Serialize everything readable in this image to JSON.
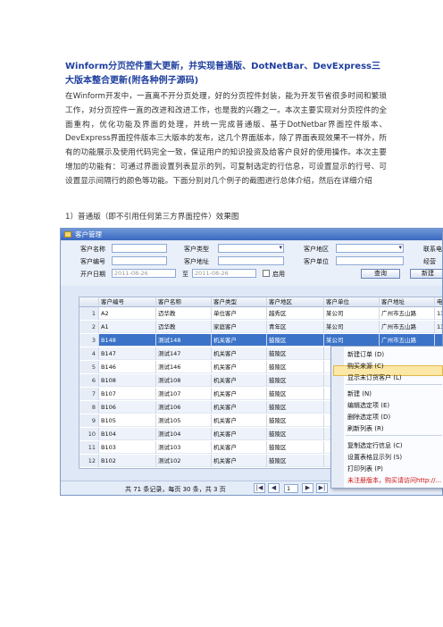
{
  "document": {
    "title": "Winform分页控件重大更新，并实现普通版、DotNetBar、DevExpress三大版本整合更新(附各种例子源码)",
    "body": "在Winform开发中，一直离不开分页处理，好的分页控件封装，能为开发节省很多时间和繁琐工作，对分页控件一直的改进和改进工作，也是我的兴趣之一。本次主要实现对分页控件的全面重构，优化功能及界面的处理，并统一完成普通版、基于DotNetbar界面控件版本、DevExpress界面控件版本三大版本的发布，这几个界面版本，除了界面表现效果不一样外，所有的功能展示及使用代码完全一致，保证用户的知识投资及给客户良好的使用操作。本次主要增加的功能有：可通过界面设置列表显示的列，可复制选定的行信息，可设置显示的行号、可设置显示间隔行的颜色等功能。下面分别对几个例子的截图进行总体介绍，然后在详细介绍",
    "caption": "1）普通版（即不引用任何第三方界面控件）效果图"
  },
  "app": {
    "window_title": "客户管理",
    "form": {
      "customer_name_label": "客户名称",
      "customer_type_label": "客户类型",
      "customer_region_label": "客户地区",
      "contact_label": "联系电",
      "customer_code_label": "客户编号",
      "customer_address_label": "客户地址",
      "customer_unit_label": "客户单位",
      "business_label": "经营",
      "open_date_label": "开户日期",
      "date_from": "2011-08-26",
      "date_to_label": "至",
      "date_to": "2011-08-26",
      "enable_label": "启用",
      "query_button": "查询",
      "new_button": "新建"
    },
    "grid": {
      "columns": [
        "客户编号",
        "客户名称",
        "客户类型",
        "客户地区",
        "客户单位",
        "客户地址",
        "电"
      ],
      "rows": [
        {
          "num": "1",
          "cells": [
            "A2",
            "迈华教",
            "单位客户",
            "越秀区",
            "某公司",
            "广州市五山路",
            "13"
          ]
        },
        {
          "num": "2",
          "cells": [
            "A1",
            "迈华教",
            "家庭客户",
            "青年区",
            "某公司",
            "广州市五山路",
            "13"
          ]
        },
        {
          "num": "3",
          "cells": [
            "B148",
            "测试148",
            "机关客户",
            "鼓陵区",
            "某公司",
            "广州市五山路",
            ""
          ]
        },
        {
          "num": "4",
          "cells": [
            "B147",
            "测试147",
            "机关客户",
            "鼓陵区",
            "",
            "",
            ""
          ]
        },
        {
          "num": "5",
          "cells": [
            "B146",
            "测试146",
            "机关客户",
            "鼓陵区",
            "",
            "",
            ""
          ]
        },
        {
          "num": "6",
          "cells": [
            "B108",
            "测试108",
            "机关客户",
            "鼓陵区",
            "",
            "",
            ""
          ]
        },
        {
          "num": "7",
          "cells": [
            "B107",
            "测试107",
            "机关客户",
            "鼓陵区",
            "",
            "",
            ""
          ]
        },
        {
          "num": "8",
          "cells": [
            "B106",
            "测试106",
            "机关客户",
            "鼓陵区",
            "",
            "",
            ""
          ]
        },
        {
          "num": "9",
          "cells": [
            "B105",
            "测试105",
            "机关客户",
            "鼓陵区",
            "",
            "",
            ""
          ]
        },
        {
          "num": "10",
          "cells": [
            "B104",
            "测试104",
            "机关客户",
            "鼓陵区",
            "",
            "",
            ""
          ]
        },
        {
          "num": "11",
          "cells": [
            "B103",
            "测试103",
            "机关客户",
            "鼓陵区",
            "",
            "",
            ""
          ]
        },
        {
          "num": "12",
          "cells": [
            "B102",
            "测试102",
            "机关客户",
            "鼓陵区",
            "",
            "",
            ""
          ]
        }
      ],
      "selected_row": 3
    },
    "pager": {
      "summary": "共 71 条记录，每页 30 条，共 3 页",
      "current_page": "1",
      "first_icon": "first-page-icon",
      "prev_icon": "prev-page-icon",
      "next_icon": "next-page-icon",
      "last_icon": "last-page-icon"
    },
    "context_menu": {
      "items": [
        {
          "label": "新建订单 (D)"
        },
        {
          "label": "购买来源 (C)"
        },
        {
          "label": "显示末订货客户 (L)"
        },
        {
          "label": "新建 (N)",
          "highlighted": true
        },
        {
          "label": "编辑选定项 (E)"
        },
        {
          "label": "删除选定项 (D)"
        },
        {
          "label": "刷新列表 (R)"
        },
        {
          "label": "复制选定行信息 (C)"
        },
        {
          "label": "设置表格显示列 (S)"
        },
        {
          "label": "打印列表 (P)"
        },
        {
          "label": "未注册版本，购买请访问http://...",
          "warning": true
        }
      ]
    }
  }
}
